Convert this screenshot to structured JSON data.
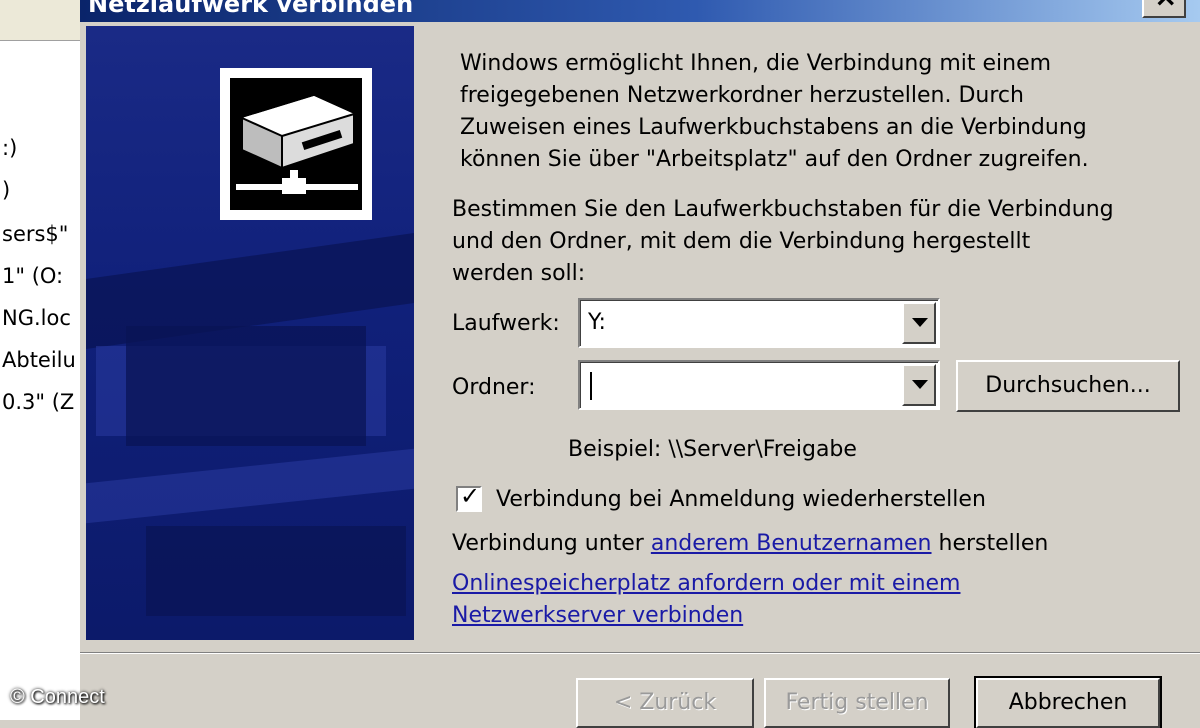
{
  "background_window": {
    "lines": [
      ":)",
      ")",
      "sers$\"",
      "1\" (O:",
      "NG.loc",
      "Abteilu",
      "0.3\" (Z"
    ]
  },
  "watermark": "© Connect",
  "dialog": {
    "title": "Netzlaufwerk verbinden",
    "close_label": "×",
    "intro_lines": [
      "Windows ermöglicht Ihnen, die Verbindung mit einem",
      "freigegebenen Netzwerkordner herzustellen. Durch",
      "Zuweisen eines Laufwerkbuchstabens an die Verbindung",
      "können Sie über \"Arbeitsplatz\" auf den Ordner zugreifen."
    ],
    "instruction_lines": [
      "Bestimmen Sie den Laufwerkbuchstaben für die Verbindung",
      "und den Ordner, mit dem die Verbindung hergestellt",
      "werden soll:"
    ],
    "drive": {
      "label": "Laufwerk:",
      "value": "Y:"
    },
    "folder": {
      "label": "Ordner:",
      "value": ""
    },
    "browse_label": "Durchsuchen...",
    "example": "Beispiel: \\\\Server\\Freigabe",
    "reconnect": {
      "label": "Verbindung bei Anmeldung wiederherstellen",
      "checked": true
    },
    "other_user": {
      "prefix": "Verbindung unter ",
      "link": "anderem Benutzernamen",
      "suffix": " herstellen"
    },
    "online_storage_link": [
      "Onlinespeicherplatz anfordern oder mit einem",
      "Netzwerkserver verbinden"
    ],
    "buttons": {
      "back": "< Zurück",
      "finish": "Fertig stellen",
      "cancel": "Abbrechen"
    },
    "colors": {
      "panel": "#10207a",
      "link": "#1a1aa6",
      "title_start": "#0a246a"
    },
    "icons": {
      "drive": "network-drive-icon",
      "check": "checkmark-icon",
      "dropdown": "chevron-down-icon"
    }
  }
}
